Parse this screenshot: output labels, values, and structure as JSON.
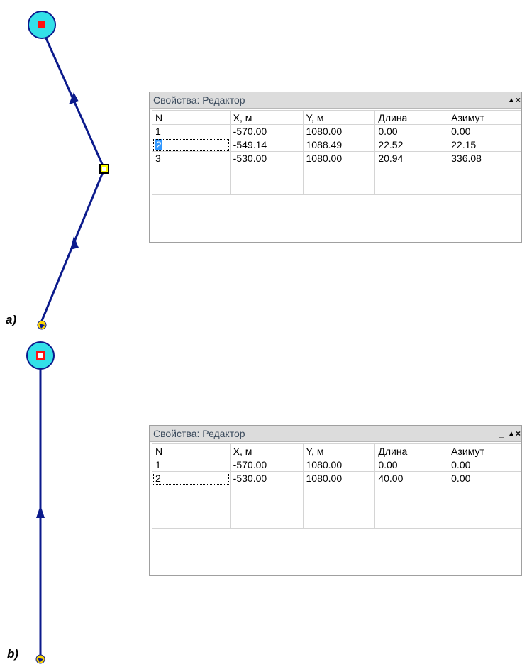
{
  "figure_a": {
    "label": "a)",
    "panel": {
      "title": "Свойства: Редактор",
      "controls": [
        "_",
        "▲",
        "×"
      ],
      "headers": [
        "N",
        "X, м",
        "Y, м",
        "Длина",
        "Азимут"
      ],
      "rows": [
        [
          "1",
          "-570.00",
          "1080.00",
          "0.00",
          "0.00"
        ],
        [
          "2",
          "-549.14",
          "1088.49",
          "22.52",
          "22.15"
        ],
        [
          "3",
          "-530.00",
          "1080.00",
          "20.94",
          "336.08"
        ]
      ],
      "selected_cell": "2"
    }
  },
  "figure_b": {
    "label": "b)",
    "panel": {
      "title": "Свойства: Редактор",
      "controls": [
        "_",
        "▲",
        "×"
      ],
      "headers": [
        "N",
        "X, м",
        "Y, м",
        "Длина",
        "Азимут"
      ],
      "rows": [
        [
          "1",
          "-570.00",
          "1080.00",
          "0.00",
          "0.00"
        ],
        [
          "2",
          "-530.00",
          "1080.00",
          "40.00",
          "0.00"
        ]
      ]
    }
  },
  "colors": {
    "line": "#0b1a8c",
    "node_fill": "#33e0e8",
    "node_marker": "#ff1010",
    "panel_title_bg": "#dcdcdc",
    "selection": "#3399ff"
  }
}
